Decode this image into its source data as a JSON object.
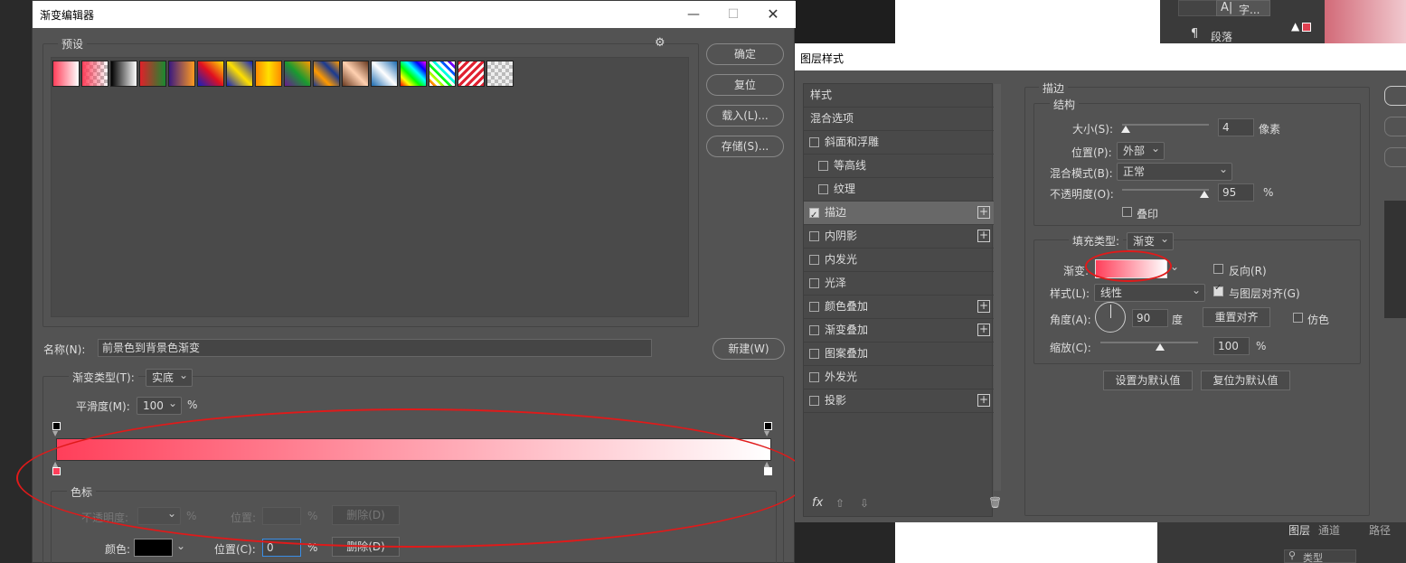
{
  "gradient_editor": {
    "title": "渐变编辑器",
    "presets_label": "预设",
    "buttons": {
      "ok": "确定",
      "reset": "复位",
      "load": "载入(L)...",
      "save": "存储(S)...",
      "new": "新建(W)"
    },
    "name_label": "名称(N):",
    "name_value": "前景色到背景色渐变",
    "gradient_type_label": "渐变类型(T):",
    "gradient_type_value": "实底",
    "smoothness_label": "平滑度(M):",
    "smoothness_value": "100",
    "percent": "%",
    "color_stops": {
      "group_label": "色标",
      "opacity_label": "不透明度:",
      "position_label": "位置:",
      "delete_label": "删除(D)",
      "color_label": "颜色:",
      "color_position_label": "位置(C):",
      "color_position_value": "0",
      "color_delete_label": "删除(D)"
    },
    "gradient_start": "#ff3f5a",
    "gradient_end": "#ffffff"
  },
  "layer_style": {
    "title": "图层样式",
    "list": [
      {
        "label": "样式"
      },
      {
        "label": "混合选项"
      },
      {
        "label": "斜面和浮雕"
      },
      {
        "label": "等高线"
      },
      {
        "label": "纹理"
      },
      {
        "label": "描边"
      },
      {
        "label": "内阴影"
      },
      {
        "label": "内发光"
      },
      {
        "label": "光泽"
      },
      {
        "label": "颜色叠加"
      },
      {
        "label": "渐变叠加"
      },
      {
        "label": "图案叠加"
      },
      {
        "label": "外发光"
      },
      {
        "label": "投影"
      }
    ],
    "stroke": {
      "group_label": "描边",
      "structure_label": "结构",
      "size_label": "大小(S):",
      "size_value": "4",
      "size_unit": "像素",
      "position_label": "位置(P):",
      "position_value": "外部",
      "blend_label": "混合模式(B):",
      "blend_value": "正常",
      "opacity_label": "不透明度(O):",
      "opacity_value": "95",
      "percent": "%",
      "overprint_label": "叠印",
      "fill_type_label": "填充类型:",
      "fill_type_value": "渐变",
      "gradient_label": "渐变:",
      "reverse_label": "反向(R)",
      "style_label": "样式(L):",
      "style_value": "线性",
      "align_label": "与图层对齐(G)",
      "angle_label": "角度(A):",
      "angle_value": "90",
      "angle_unit": "度",
      "reset_align_label": "重置对齐",
      "dither_label": "仿色",
      "scale_label": "缩放(C):",
      "scale_value": "100",
      "set_default": "设置为默认值",
      "reset_default": "复位为默认值"
    }
  },
  "right_panel": {
    "char_label": "字...",
    "paragraph_label": "段落",
    "tabs": [
      "图层",
      "通道",
      "路径"
    ],
    "search_placeholder": "类型"
  }
}
